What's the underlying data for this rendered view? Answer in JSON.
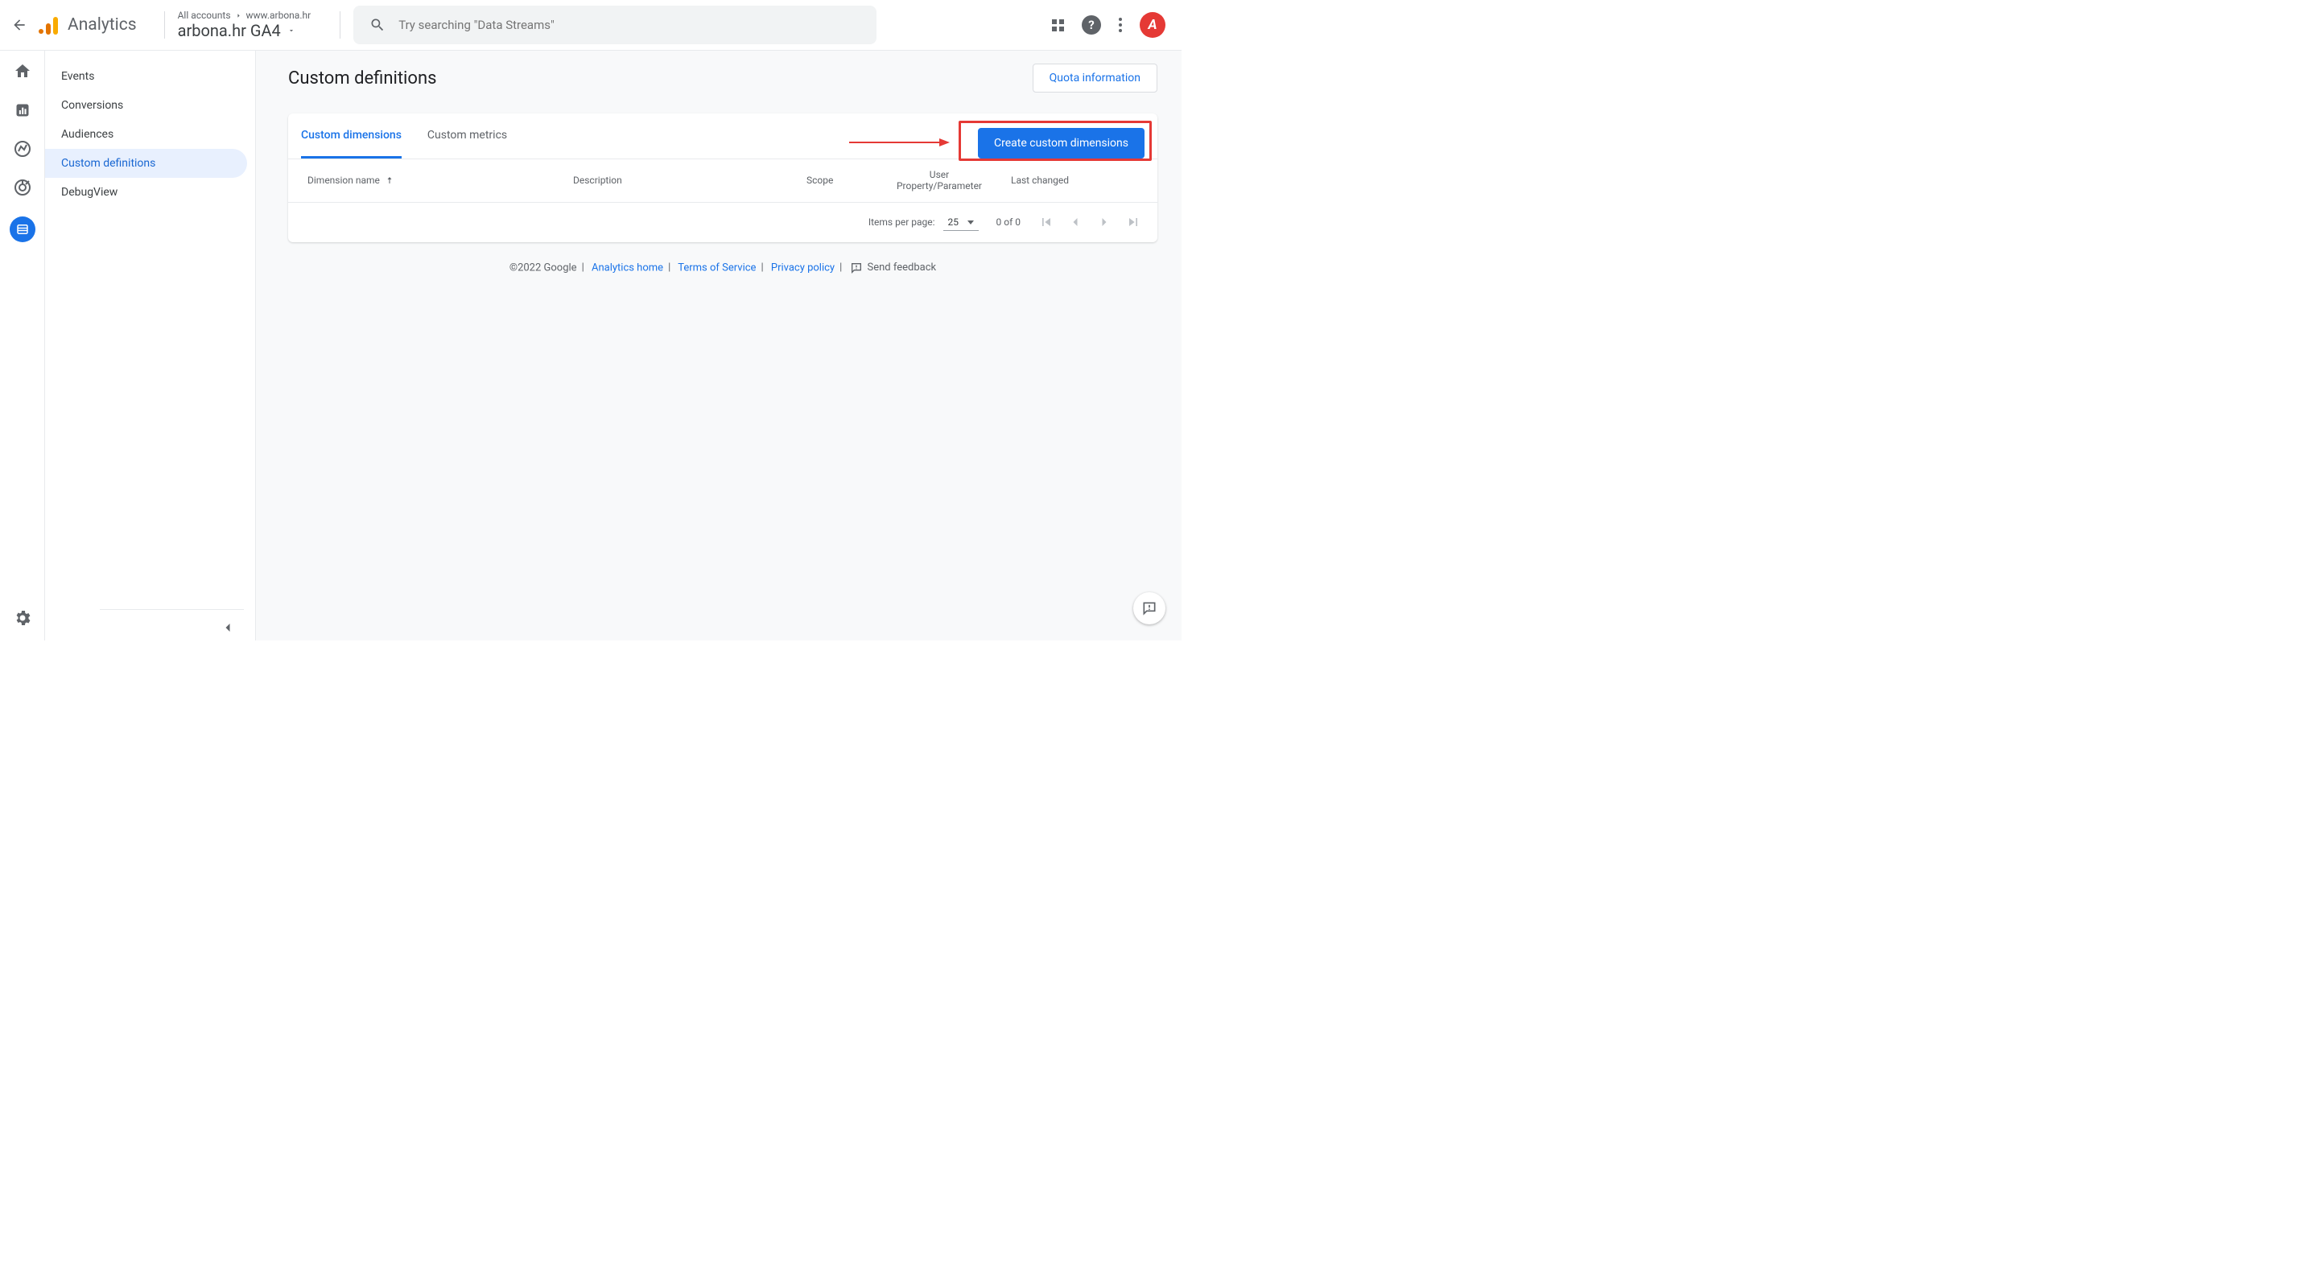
{
  "app": {
    "name": "Analytics"
  },
  "breadcrumb": {
    "root": "All accounts",
    "current": "www.arbona.hr"
  },
  "property": {
    "name": "arbona.hr GA4"
  },
  "search": {
    "placeholder": "Try searching \"Data Streams\""
  },
  "avatar": {
    "letter": "A"
  },
  "sidebar": {
    "items": [
      {
        "label": "Events"
      },
      {
        "label": "Conversions"
      },
      {
        "label": "Audiences"
      },
      {
        "label": "Custom definitions"
      },
      {
        "label": "DebugView"
      }
    ]
  },
  "page": {
    "title": "Custom definitions",
    "quota_btn": "Quota information"
  },
  "tabs": {
    "dimensions": "Custom dimensions",
    "metrics": "Custom metrics"
  },
  "actions": {
    "create": "Create custom dimensions"
  },
  "table": {
    "columns": {
      "name": "Dimension name",
      "description": "Description",
      "scope": "Scope",
      "user_prop_line1": "User",
      "user_prop_line2": "Property/Parameter",
      "last_changed": "Last changed"
    }
  },
  "paginator": {
    "items_per_page": "Items per page:",
    "value": "25",
    "range": "0 of 0"
  },
  "footer": {
    "copyright": "©2022 Google",
    "home": "Analytics home",
    "terms": "Terms of Service",
    "privacy": "Privacy policy",
    "feedback": "Send feedback"
  }
}
